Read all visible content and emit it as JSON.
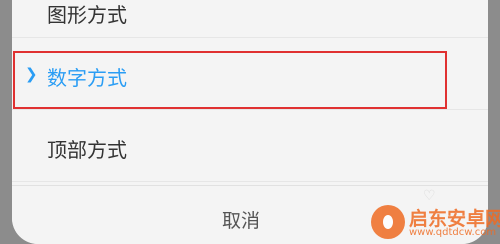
{
  "options": {
    "items": [
      {
        "label": "图形方式",
        "selected": false
      },
      {
        "label": "数字方式",
        "selected": true
      },
      {
        "label": "顶部方式",
        "selected": false
      }
    ],
    "selected_marker_icon": "chevron-right-icon"
  },
  "footer": {
    "cancel_label": "取消"
  },
  "watermark": {
    "title": "启东安卓网",
    "url": "www.qdtdcw.com",
    "logo_icon": "flame-logo-icon"
  },
  "colors": {
    "accent": "#2a9df4",
    "highlight_border": "#e03131",
    "watermark": "#ef6b22",
    "text": "#333333",
    "sheet_background": "#f4f4f4"
  }
}
